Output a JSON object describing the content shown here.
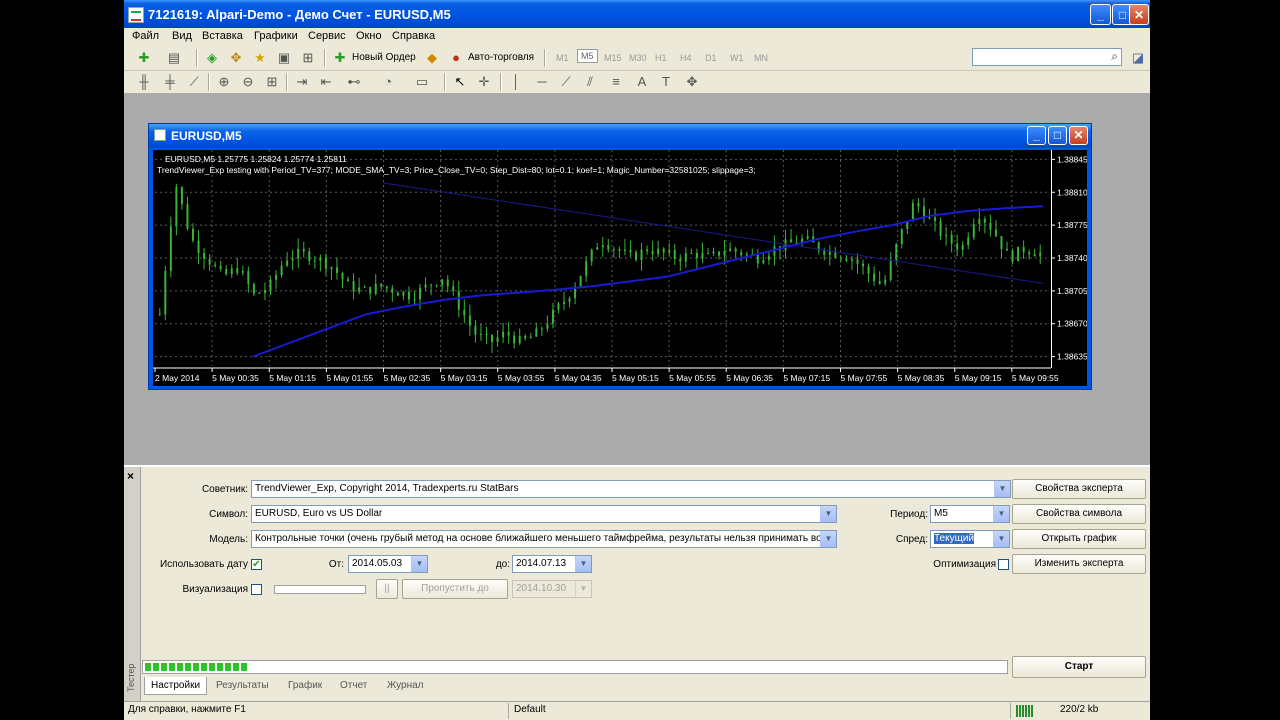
{
  "window": {
    "title": "7121619: Alpari-Demo - Демо Счет - EURUSD,M5",
    "minimize": "_",
    "maximize": "□",
    "close": "✕"
  },
  "menu": [
    "Файл",
    "Вид",
    "Вставка",
    "Графики",
    "Сервис",
    "Окно",
    "Справка"
  ],
  "toolbar": {
    "new_order": "Новый Ордер",
    "auto_trading": "Авто-торговля",
    "timeframes": [
      "M1",
      "M5",
      "M15",
      "M30",
      "H1",
      "H4",
      "D1",
      "W1",
      "MN"
    ],
    "active_timeframe": "M5"
  },
  "chart": {
    "window_title": "EURUSD,M5",
    "info_line1": "EURUSD,M5  1.25775 1.25824 1.25774 1.25811",
    "info_line2": "TrendViewer_Exp testing with Period_TV=377; MODE_SMA_TV=3; Price_Close_TV=0; Step_Dist=80; lot=0.1; koef=1; Magic_Number=32581025; slippage=3;",
    "colors": {
      "background": "#000000",
      "grid": "#5a5a5a",
      "candles": "#3bb33b",
      "ma": "#1a1ad6",
      "axis_text": "#ffffff"
    }
  },
  "chart_data": {
    "type": "line",
    "x_ticks": [
      "2 May 2014",
      "5 May 00:35",
      "5 May 01:15",
      "5 May 01:55",
      "5 May 02:35",
      "5 May 03:15",
      "5 May 03:55",
      "5 May 04:35",
      "5 May 05:15",
      "5 May 05:55",
      "5 May 06:35",
      "5 May 07:15",
      "5 May 07:55",
      "5 May 08:35",
      "5 May 09:15",
      "5 May 09:55"
    ],
    "y_ticks": [
      1.38845,
      1.3881,
      1.38775,
      1.3874,
      1.38705,
      1.3867,
      1.38635
    ],
    "ylim": [
      1.38625,
      1.38855
    ],
    "bar_count": 160,
    "close": [
      1.3868,
      1.3882,
      1.3876,
      1.3874,
      1.3872,
      1.3873,
      1.387,
      1.3871,
      1.3874,
      1.38745,
      1.3874,
      1.3873,
      1.3871,
      1.38705,
      1.3871,
      1.38705,
      1.387,
      1.3871,
      1.3872,
      1.3869,
      1.3866,
      1.3865,
      1.3866,
      1.3865,
      1.3866,
      1.3868,
      1.387,
      1.3873,
      1.3876,
      1.3875,
      1.3874,
      1.3875,
      1.38745,
      1.3874,
      1.38745,
      1.3874,
      1.3875,
      1.38745,
      1.3874,
      1.3875,
      1.38755,
      1.3876,
      1.3875,
      1.38745,
      1.3874,
      1.38725,
      1.3871,
      1.3876,
      1.388,
      1.3878,
      1.3876,
      1.3875,
      1.3879,
      1.3877,
      1.3874,
      1.3875,
      1.38745
    ],
    "ma": [
      1.38635,
      1.3865,
      1.38665,
      1.3868,
      1.38688,
      1.38695,
      1.387,
      1.38703,
      1.38706,
      1.3871,
      1.38715,
      1.3872,
      1.3873,
      1.3874,
      1.3875,
      1.3876,
      1.38768,
      1.38775,
      1.38785,
      1.3879,
      1.38793,
      1.38795
    ]
  },
  "tester": {
    "side_label": "Тестер",
    "expert_label": "Советник:",
    "expert_value": "TrendViewer_Exp, Copyright 2014, Tradexperts.ru StatBars",
    "expert_props_btn": "Свойства эксперта",
    "symbol_label": "Символ:",
    "symbol_value": "EURUSD, Euro vs US Dollar",
    "symbol_props_btn": "Свойства символа",
    "period_label": "Период:",
    "period_value": "M5",
    "model_label": "Модель:",
    "model_value": "Контрольные точки (очень грубый метод на основе ближайшего меньшего таймфрейма, результаты нельзя принимать во в",
    "spread_label": "Спред:",
    "spread_value": "Текущий",
    "open_chart_btn": "Открыть график",
    "use_date_label": "Использовать дату",
    "use_date_checked": true,
    "from_label": "От:",
    "from_value": "2014.05.03",
    "to_label": "до:",
    "to_value": "2014.07.13",
    "optimization_label": "Оптимизация",
    "edit_expert_btn": "Изменить эксперта",
    "visualization_label": "Визуализация",
    "pause_btn": "||",
    "skip_to_btn": "Пропустить до",
    "skip_to_value": "2014.10.30",
    "progress": 0.12,
    "start_btn": "Старт",
    "tabs": [
      "Настройки",
      "Результаты",
      "График",
      "Отчет",
      "Журнал"
    ],
    "active_tab": "Настройки",
    "close_x": "×"
  },
  "statusbar": {
    "help": "Для справки, нажмите F1",
    "profile": "Default",
    "traffic": "220/2 kb"
  }
}
